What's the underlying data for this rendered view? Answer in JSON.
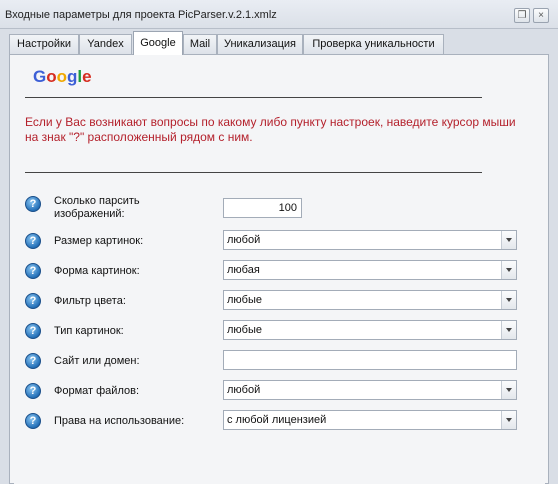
{
  "window": {
    "title": "Входные параметры для проекта PicParser.v.2.1.xmlz"
  },
  "tabs": [
    {
      "label": "Настройки"
    },
    {
      "label": "Yandex"
    },
    {
      "label": "Google"
    },
    {
      "label": "Mail"
    },
    {
      "label": "Уникализация"
    },
    {
      "label": "Проверка уникальности"
    }
  ],
  "active_tab": "Google",
  "logo": {
    "letters": [
      "G",
      "o",
      "o",
      "g",
      "l",
      "e"
    ],
    "colors": [
      "#3c5fd6",
      "#d62d20",
      "#f0a800",
      "#3c5fd6",
      "#1a9c3e",
      "#d62d20"
    ]
  },
  "notice": "Если у Вас возникают вопросы по какому либо пункту настроек, наведите курсор мыши на знак \"?\" расположенный рядом с ним.",
  "help_icon_glyph": "?",
  "fields": [
    {
      "label": "Сколько парсить изображений:",
      "type": "number",
      "value": "100"
    },
    {
      "label": "Размер картинок:",
      "type": "dropdown",
      "value": "любой"
    },
    {
      "label": "Форма картинок:",
      "type": "dropdown",
      "value": "любая"
    },
    {
      "label": "Фильтр цвета:",
      "type": "dropdown",
      "value": "любые"
    },
    {
      "label": "Тип картинок:",
      "type": "dropdown",
      "value": "любые"
    },
    {
      "label": "Сайт или домен:",
      "type": "text",
      "value": ""
    },
    {
      "label": "Формат файлов:",
      "type": "dropdown",
      "value": "любой"
    },
    {
      "label": "Права на использование:",
      "type": "dropdown",
      "value": "с любой лицензией"
    }
  ]
}
